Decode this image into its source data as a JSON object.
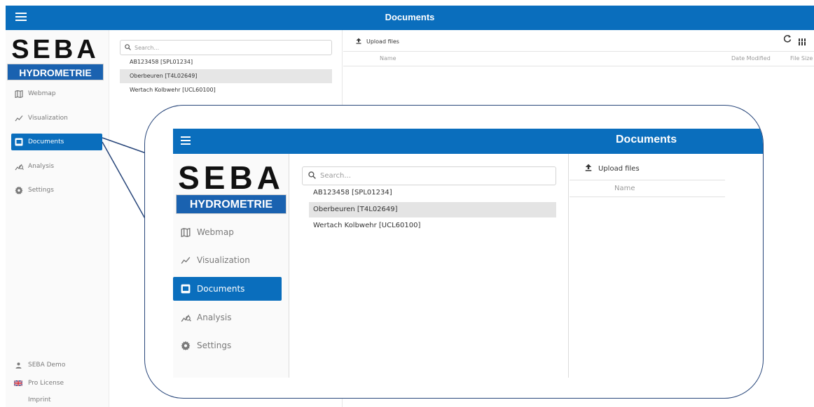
{
  "app": {
    "title": "Documents",
    "logo": {
      "top": "SEBA",
      "bottom": "HYDROMETRIE"
    },
    "accent_color": "#0a6ebd"
  },
  "sidebar": {
    "items": [
      {
        "label": "Webmap",
        "icon": "map-icon",
        "active": false
      },
      {
        "label": "Visualization",
        "icon": "line-chart-icon",
        "active": false
      },
      {
        "label": "Documents",
        "icon": "documents-icon",
        "active": true
      },
      {
        "label": "Analysis",
        "icon": "analysis-icon",
        "active": false
      },
      {
        "label": "Settings",
        "icon": "gear-icon",
        "active": false
      }
    ],
    "footer": [
      {
        "label": "SEBA Demo",
        "icon": "user-icon"
      },
      {
        "label": "Pro License",
        "icon": "uk-flag-icon"
      },
      {
        "label": "Imprint",
        "icon": ""
      }
    ]
  },
  "stations": {
    "search_placeholder": "Search...",
    "items": [
      {
        "label": "AB123458 [SPL01234]",
        "selected": false
      },
      {
        "label": "Oberbeuren [T4L02649]",
        "selected": true
      },
      {
        "label": "Wertach Kolbwehr [UCL60100]",
        "selected": false
      }
    ]
  },
  "documents": {
    "upload_label": "Upload files",
    "columns": [
      "Name",
      "Date Modified",
      "File Size"
    ]
  }
}
